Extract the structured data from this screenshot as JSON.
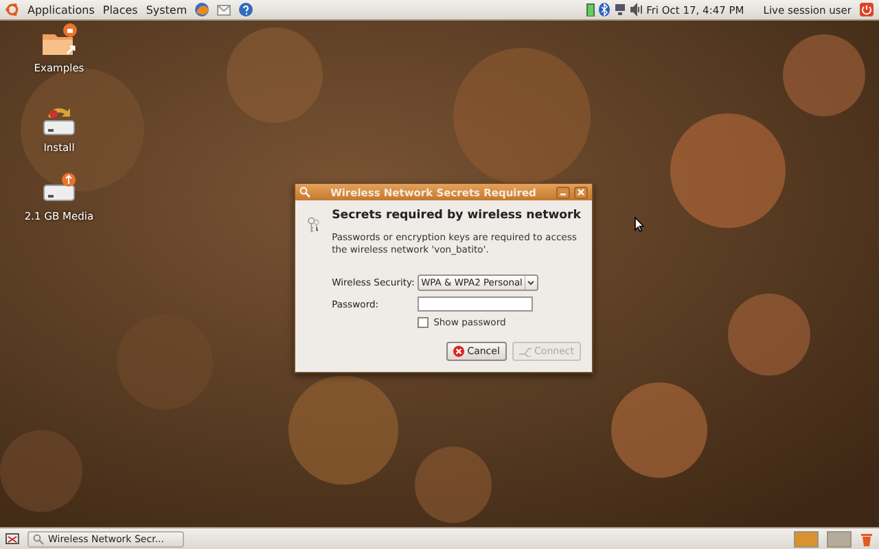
{
  "top_panel": {
    "menus": [
      "Applications",
      "Places",
      "System"
    ],
    "clock": "Fri Oct 17,  4:47 PM",
    "user": "Live session user"
  },
  "desktop_icons": [
    {
      "label": "Examples",
      "kind": "folder"
    },
    {
      "label": "Install",
      "kind": "installer"
    },
    {
      "label": "2.1 GB Media",
      "kind": "drive"
    }
  ],
  "dialog": {
    "title": "Wireless Network Secrets Required",
    "heading": "Secrets required by wireless network",
    "message": "Passwords or encryption keys are required to access the wireless network 'von_batito'.",
    "security_label": "Wireless Security:",
    "security_value": "WPA & WPA2 Personal",
    "password_label": "Password:",
    "show_password": {
      "label": "Show password",
      "checked": false
    },
    "buttons": [
      {
        "label": "Cancel",
        "kind": "cancel",
        "disabled": false
      },
      {
        "label": "Connect",
        "kind": "connect",
        "disabled": true
      }
    ]
  },
  "bottom_panel": {
    "tasks": [
      {
        "label": "Wireless Network Secr...",
        "selected": false
      }
    ],
    "workspaces": [
      {
        "selected": true
      },
      {
        "selected": false
      }
    ]
  }
}
